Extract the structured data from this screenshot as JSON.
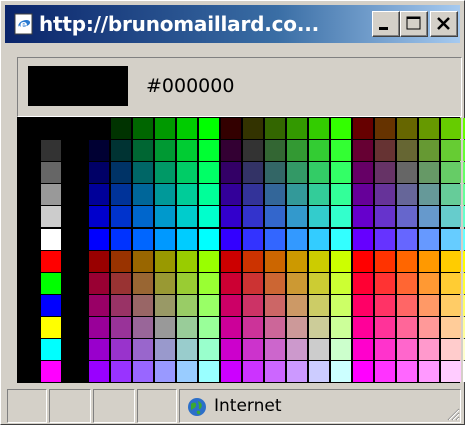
{
  "window": {
    "title": "http://brunomaillard.co...",
    "icon": "ie-page-icon",
    "controls": {
      "minimize": "minimize-icon",
      "maximize": "maximize-icon",
      "close": "close-icon"
    }
  },
  "preview": {
    "color": "#000000",
    "hex": "#000000"
  },
  "palette": {
    "grays": [
      "#333333",
      "#666666",
      "#999999",
      "#cccccc",
      "#ffffff"
    ],
    "primaries": [
      "#ff0000",
      "#00ff00",
      "#0000ff",
      "#ffff00",
      "#00ffff",
      "#ff00ff"
    ]
  },
  "statusbar": {
    "zone": "Internet",
    "zone_icon": "globe-icon"
  }
}
